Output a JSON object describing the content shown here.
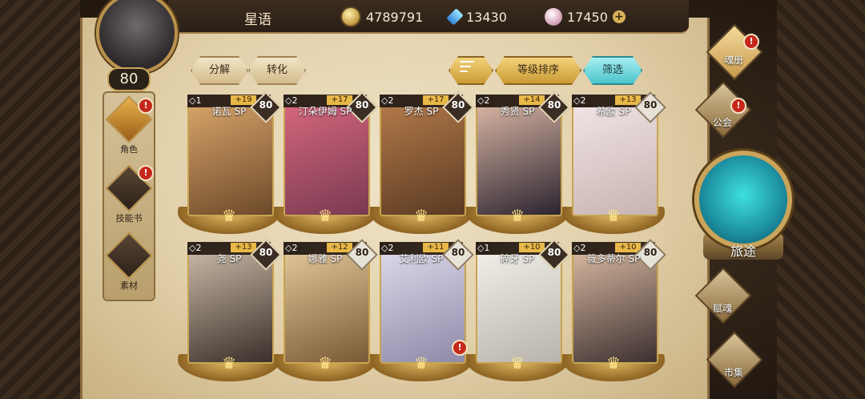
{
  "player": {
    "name": "星语",
    "level": "80"
  },
  "currency": [
    {
      "icon": "coin-icon",
      "value": "4789791"
    },
    {
      "icon": "blue-crystal-icon",
      "value": "13430"
    },
    {
      "icon": "pink-gem-icon",
      "value": "17450"
    }
  ],
  "left_nav": [
    {
      "label": "角色",
      "icon": "character-icon",
      "active": true,
      "alert": true
    },
    {
      "label": "技能书",
      "icon": "skillbook-icon",
      "active": false,
      "alert": true
    },
    {
      "label": "素材",
      "icon": "material-icon",
      "active": false,
      "alert": false
    }
  ],
  "actions": {
    "decompose": "分解",
    "convert": "转化",
    "sort_level": "等级排序",
    "filter": "筛选"
  },
  "cards": [
    {
      "name": "诺瓦 SP",
      "tier": "1",
      "plus": "+19",
      "level": "80",
      "dark_level": true,
      "alert": false,
      "colors": [
        "#6d4a2a",
        "#d8a46a"
      ]
    },
    {
      "name": "汀朵伊姆 SP",
      "tier": "2",
      "plus": "+17",
      "level": "80",
      "dark_level": true,
      "alert": false,
      "colors": [
        "#7a3a52",
        "#d5677c"
      ]
    },
    {
      "name": "罗杰 SP",
      "tier": "2",
      "plus": "+17",
      "level": "80",
      "dark_level": true,
      "alert": false,
      "colors": [
        "#5a3a22",
        "#b37a4a"
      ]
    },
    {
      "name": "秀贤 SP",
      "tier": "2",
      "plus": "+14",
      "level": "80",
      "dark_level": true,
      "alert": false,
      "colors": [
        "#2c2430",
        "#d9b6a4"
      ]
    },
    {
      "name": "希欧 SP",
      "tier": "2",
      "plus": "+13",
      "level": "80",
      "dark_level": false,
      "alert": false,
      "colors": [
        "#c7b4b0",
        "#f1e4e6"
      ]
    },
    {
      "name": "尧 SP",
      "tier": "2",
      "plus": "+13",
      "level": "80",
      "dark_level": true,
      "alert": false,
      "colors": [
        "#3a302a",
        "#c9b8a6"
      ]
    },
    {
      "name": "娜雅 SP",
      "tier": "2",
      "plus": "+12",
      "level": "80",
      "dark_level": false,
      "alert": false,
      "colors": [
        "#7a5a36",
        "#e3c79a"
      ]
    },
    {
      "name": "艾利欧 SP",
      "tier": "2",
      "plus": "+11",
      "level": "80",
      "dark_level": false,
      "alert": true,
      "colors": [
        "#8e8aa8",
        "#dcd8ea"
      ]
    },
    {
      "name": "碎牙 SP",
      "tier": "1",
      "plus": "+10",
      "level": "80",
      "dark_level": true,
      "alert": false,
      "colors": [
        "#b8b4ac",
        "#f1efe8"
      ]
    },
    {
      "name": "薇多蒂尔 SP",
      "tier": "2",
      "plus": "+10",
      "level": "80",
      "dark_level": false,
      "alert": false,
      "colors": [
        "#3c3030",
        "#d8b8a0"
      ]
    }
  ],
  "right_nav": {
    "soul_book": "魂册",
    "guild": "公会",
    "journey": "旅途",
    "talent": "赋魂",
    "market": "市集"
  }
}
